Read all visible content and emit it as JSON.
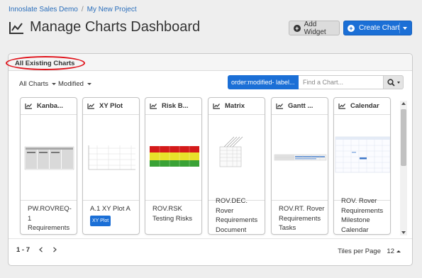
{
  "breadcrumb": {
    "items": [
      "Innoslate Sales Demo",
      "My New Project"
    ],
    "separator": "/"
  },
  "page": {
    "title": "Manage Charts Dashboard"
  },
  "toolbar": {
    "add_widget_label": "Add Widget",
    "create_chart_label": "Create Chart"
  },
  "panel": {
    "title": "All Existing Charts",
    "filters": {
      "type_label": "All Charts",
      "sort_label": "Modified"
    },
    "search": {
      "tag": "order:modified- label...",
      "placeholder": "Find a Chart..."
    }
  },
  "cards": [
    {
      "title": "Kanba...",
      "desc_lines": [
        "PW.ROVREQ-",
        "1",
        "Requirements"
      ],
      "tag": ""
    },
    {
      "title": "XY Plot",
      "desc_lines": [
        "A.1 XY Plot A"
      ],
      "tag": "XY Plot"
    },
    {
      "title": "Risk B...",
      "desc_lines": [
        "ROV.RSK",
        "Testing Risks"
      ],
      "tag": ""
    },
    {
      "title": "Matrix",
      "desc_lines": [
        "ROV.DEC.",
        "Rover",
        "Requirements",
        "Document"
      ],
      "tag": ""
    },
    {
      "title": "Gantt ...",
      "desc_lines": [
        "ROV.RT. Rover",
        "Requirements",
        "Tasks"
      ],
      "tag": ""
    },
    {
      "title": "Calendar",
      "desc_lines": [
        "ROV. Rover",
        "Requirements",
        "Milestone",
        "Calendar"
      ],
      "tag": ""
    }
  ],
  "pagination": {
    "range": "1 - 7",
    "tiles_label": "Tiles per Page",
    "tiles_value": "12"
  },
  "colors": {
    "accent": "#1b6fd6",
    "highlight_oval": "#e0131b",
    "background": "#eeeeee"
  },
  "icons": [
    "chart-icon",
    "plus-circle-icon",
    "search-icon",
    "caret-down-icon",
    "chevron-left-icon",
    "chevron-right-icon"
  ]
}
